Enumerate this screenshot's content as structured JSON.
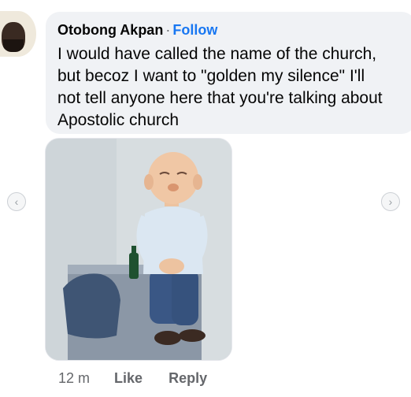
{
  "comment": {
    "author": "Otobong Akpan",
    "separator": "·",
    "follow_label": "Follow",
    "text": "I would have called the name of the church,\nbut becoz I want to \"golden my silence\" I'll\nnot tell anyone here that you're talking about\nApostolic church",
    "time": "12 m",
    "like_label": "Like",
    "reply_label": "Reply"
  },
  "icons": {
    "prev": "chevron-left-icon",
    "next": "chevron-right-icon"
  },
  "colors": {
    "bubble": "#f0f2f5",
    "link": "#1877f2",
    "text": "#050505",
    "muted": "#65676b"
  }
}
